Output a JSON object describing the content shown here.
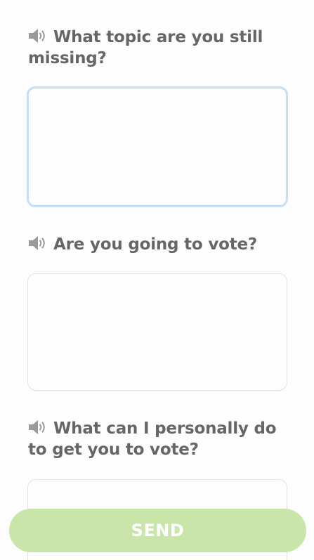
{
  "questions": [
    {
      "speaker_icon": "speaker-icon",
      "text": "What topic are you still missing?",
      "answer_value": ""
    },
    {
      "speaker_icon": "speaker-icon",
      "text": "Are you going to vote?",
      "answer_value": ""
    },
    {
      "speaker_icon": "speaker-icon",
      "text": "What can I personally do to get you to vote?",
      "answer_value": ""
    }
  ],
  "send_button": {
    "label": "SEND"
  },
  "colors": {
    "question_text": "#666666",
    "speaker_icon": "#9a9a9a",
    "field_border": "#e2e2e2",
    "focused_border": "#c7ddf3",
    "send_background": "#c9e5a9",
    "send_text": "#ffffff"
  }
}
